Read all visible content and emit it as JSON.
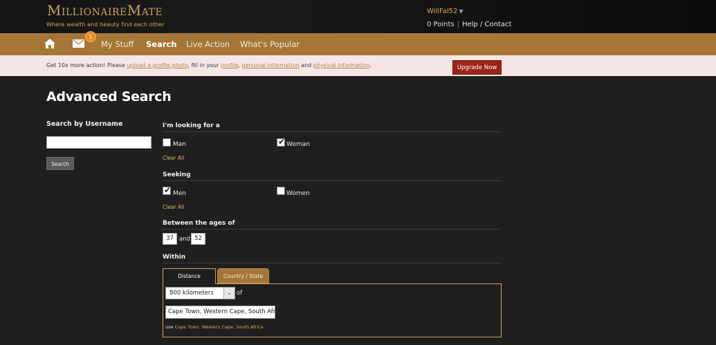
{
  "header": {
    "logo": "MillionaireMate",
    "tagline": "Where wealth and beauty find each other",
    "username": "WillFal52",
    "points": "0 Points",
    "help_contact": "Help / Contact"
  },
  "nav": {
    "mail_badge": "1",
    "items": [
      "My Stuff",
      "Search",
      "Live Action",
      "What's Popular"
    ],
    "active": "Search"
  },
  "promo": {
    "text_start": "Get 10x more action! Please ",
    "link_photo": "upload a profile photo",
    "text_mid1": ", fill in your ",
    "link_profile": "profile",
    "text_sep": ", ",
    "link_personal": "personal information",
    "text_and": " and ",
    "link_physical": "physical information",
    "text_end": ".",
    "upgrade_label": "Upgrade Now"
  },
  "main": {
    "title": "Advanced Search",
    "username_search": {
      "heading": "Search by Username",
      "value": "",
      "button_label": "Search"
    },
    "looking_for": {
      "heading": "I'm looking for a",
      "options": [
        {
          "label": "Man",
          "checked": false
        },
        {
          "label": "Woman",
          "checked": true
        }
      ],
      "clear_label": "Clear All"
    },
    "seeking": {
      "heading": "Seeking",
      "options": [
        {
          "label": "Men",
          "checked": true
        },
        {
          "label": "Women",
          "checked": false
        }
      ],
      "clear_label": "Clear All"
    },
    "ages": {
      "heading": "Between the ages of",
      "min": "37",
      "and_label": "and",
      "max": "52"
    },
    "within": {
      "heading": "Within",
      "tabs": [
        "Distance",
        "Country / State"
      ],
      "active_tab": "Distance",
      "distance_value": "800 kilometers",
      "of_label": "of",
      "location_value": "Cape Town, Western Cape, South Afr",
      "use_label": "use ",
      "use_link": "Cape Town, Western Cape, South Africa"
    }
  },
  "colors": {
    "nav_bg": "#a67637",
    "accent_gold": "#d6a84f",
    "upgrade_red": "#9a2416",
    "badge_orange": "#f28c28",
    "promo_bg": "#f7e6e6",
    "page_bg": "#1f1f1f"
  },
  "icons": {
    "home": "home-icon",
    "mail": "mail-icon",
    "checkmark": "checkmark-icon",
    "dropdown": "chevron-down-icon"
  }
}
